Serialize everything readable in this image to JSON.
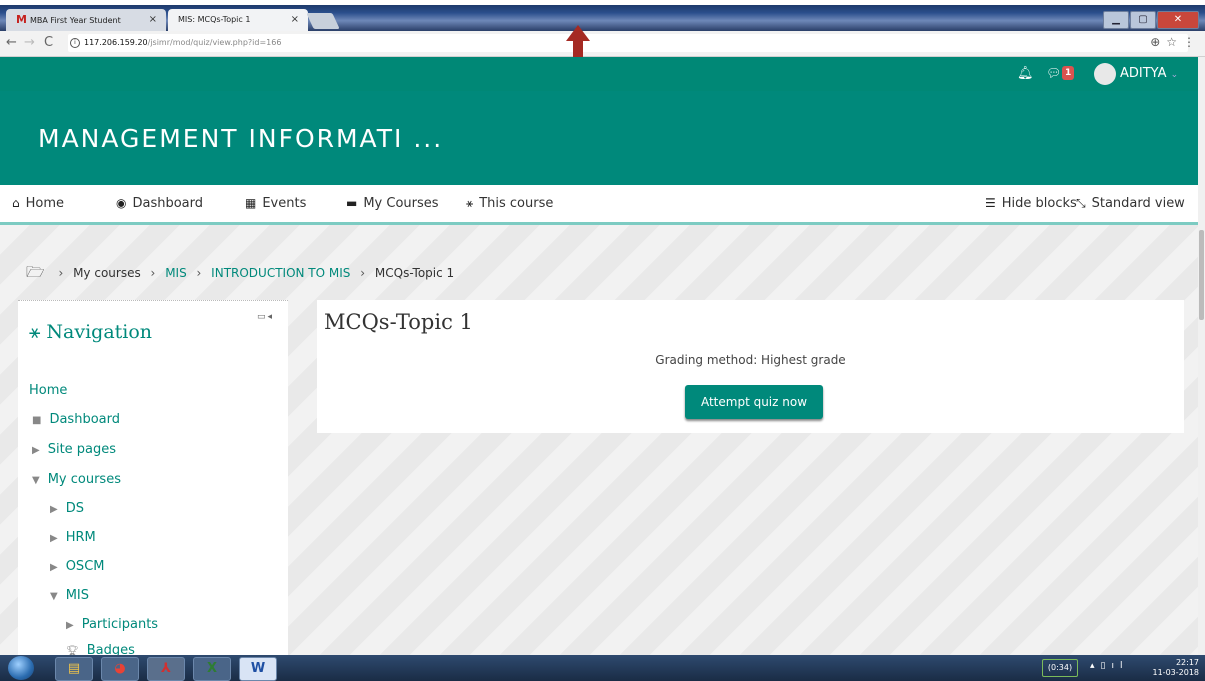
{
  "browser": {
    "tabs": [
      {
        "label": "MBA First Year Student",
        "icon": "gmail-icon"
      },
      {
        "label": "MIS: MCQs-Topic 1"
      }
    ],
    "url_host": "117.206.159.20",
    "url_path": "/jsimr/mod/quiz/view.php?id=166"
  },
  "topnav": {
    "badge_count": "1",
    "username": "ADITYA"
  },
  "site": {
    "name": "MANAGEMENT INFORMATI ..."
  },
  "menu": {
    "home": "Home",
    "dashboard": "Dashboard",
    "events": "Events",
    "my_courses": "My Courses",
    "this_course": "This course",
    "hide_blocks": "Hide blocks",
    "standard_view": "Standard view"
  },
  "breadcrumb": {
    "my_courses": "My courses",
    "mis": "MIS",
    "intro": "INTRODUCTION TO MIS",
    "current": "MCQs-Topic 1"
  },
  "navigation": {
    "title": "Navigation",
    "items": [
      "Home",
      "Dashboard",
      "Site pages",
      "My courses",
      "DS",
      "HRM",
      "OSCM",
      "MIS",
      "Participants",
      "Badges"
    ]
  },
  "main": {
    "title": "MCQs-Topic 1",
    "grading": "Grading method: Highest grade",
    "attempt_button": "Attempt quiz now"
  },
  "taskbar": {
    "battery": "(0:34)",
    "time": "22:17",
    "date": "11-03-2018"
  },
  "colors": {
    "brand": "#00897b",
    "arrow": "#a52a23"
  }
}
